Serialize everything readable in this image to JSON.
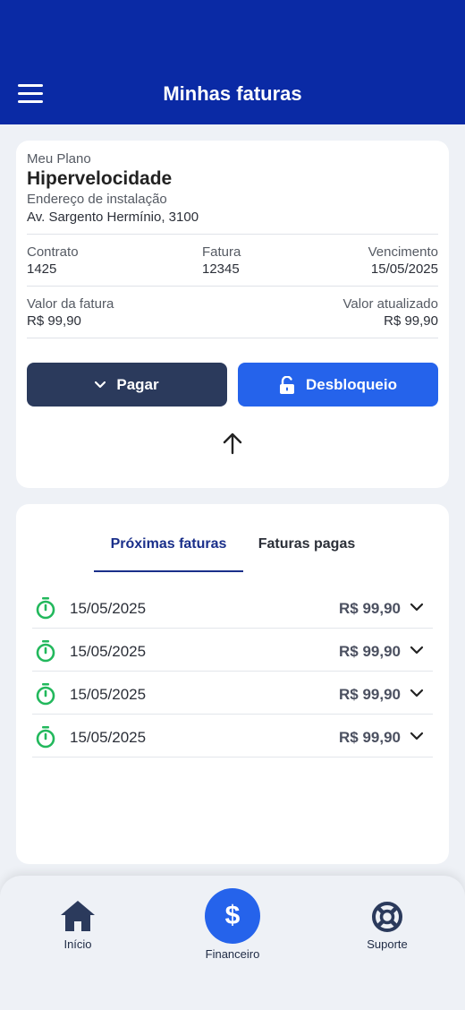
{
  "header": {
    "title": "Minhas faturas"
  },
  "plan": {
    "label": "Meu Plano",
    "name": "Hipervelocidade",
    "address_label": "Endereço de instalação",
    "address": "Av. Sargento Hermínio, 3100",
    "contract_label": "Contrato",
    "contract": "1425",
    "invoice_label": "Fatura",
    "invoice": "12345",
    "due_label": "Vencimento",
    "due": "15/05/2025",
    "amount_label": "Valor da fatura",
    "amount": "R$ 99,90",
    "updated_label": "Valor atualizado",
    "updated": "R$ 99,90",
    "pay_button": "Pagar",
    "unlock_button": "Desbloqueio"
  },
  "tabs": {
    "upcoming": "Próximas faturas",
    "paid": "Faturas pagas",
    "active": "upcoming"
  },
  "invoices": [
    {
      "date": "15/05/2025",
      "amount": "R$ 99,90"
    },
    {
      "date": "15/05/2025",
      "amount": "R$ 99,90"
    },
    {
      "date": "15/05/2025",
      "amount": "R$ 99,90"
    },
    {
      "date": "15/05/2025",
      "amount": "R$ 99,90"
    }
  ],
  "nav": {
    "home": "Início",
    "finance": "Financeiro",
    "finance_symbol": "$",
    "support": "Suporte",
    "active": "finance"
  },
  "colors": {
    "header": "#0a2aa5",
    "primary": "#2563eb",
    "dark_button": "#2b3a5c",
    "timer": "#22b85c",
    "tab_active": "#1a2f8a"
  }
}
